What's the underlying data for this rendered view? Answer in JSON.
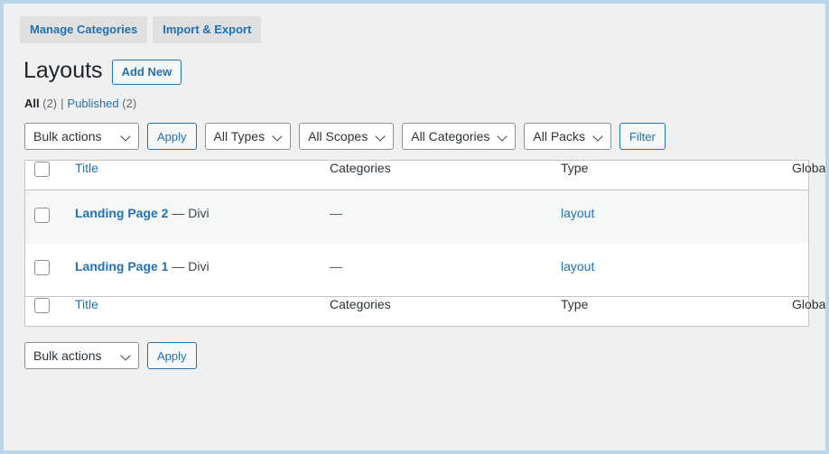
{
  "subnav": {
    "tabs": [
      {
        "label": "Manage Categories",
        "name": "manage-categories"
      },
      {
        "label": "Import & Export",
        "name": "import-export"
      }
    ]
  },
  "header": {
    "title": "Layouts",
    "add_new_label": "Add New"
  },
  "status_links": {
    "all_label": "All",
    "all_count": "(2)",
    "separator": "|",
    "published_label": "Published",
    "published_count": "(2)"
  },
  "tablenav_top": {
    "bulk_actions_label": "Bulk actions",
    "apply_label": "Apply",
    "all_types_label": "All Types",
    "all_scopes_label": "All Scopes",
    "all_categories_label": "All Categories",
    "all_packs_label": "All Packs",
    "filter_label": "Filter"
  },
  "tablenav_bottom": {
    "bulk_actions_label": "Bulk actions",
    "apply_label": "Apply"
  },
  "table": {
    "columns": {
      "title": "Title",
      "categories": "Categories",
      "type": "Type",
      "global": "Global"
    },
    "rows": [
      {
        "title": "Landing Page 2",
        "title_suffix": "— Divi",
        "categories": "—",
        "type": "layout",
        "global": ""
      },
      {
        "title": "Landing Page 1",
        "title_suffix": "— Divi",
        "categories": "—",
        "type": "layout",
        "global": ""
      }
    ]
  },
  "colors": {
    "accent_link": "#2271b1",
    "page_background": "#f0f0f1",
    "frame_border": "#b9d6ea",
    "table_border": "#c3c4c7",
    "row_alt_background": "#f6f7f7"
  }
}
